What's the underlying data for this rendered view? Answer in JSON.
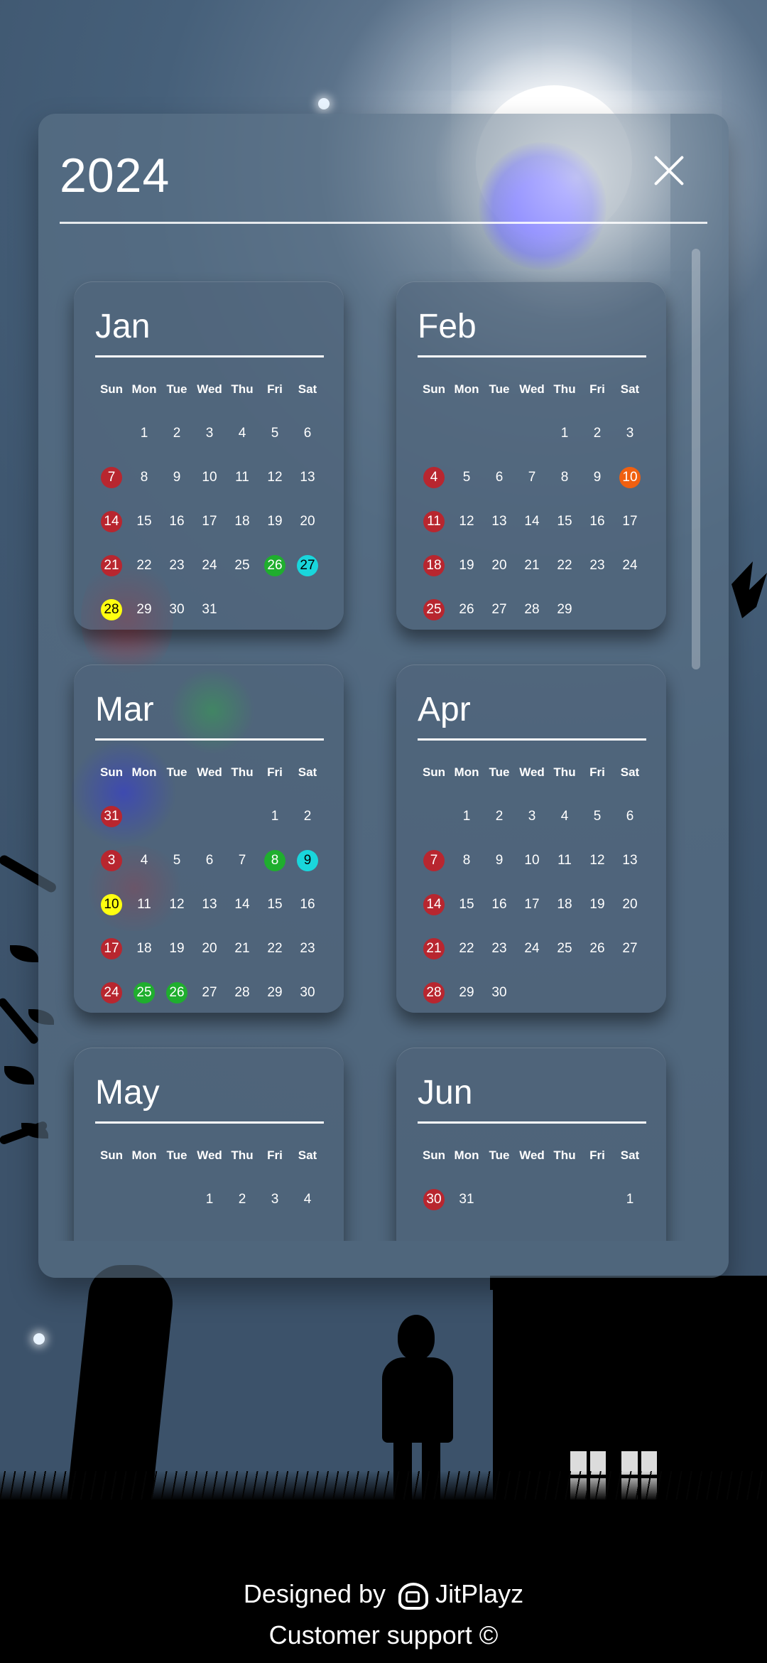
{
  "header": {
    "year": "2024",
    "close_label": "×"
  },
  "weekdays": [
    "Sun",
    "Mon",
    "Tue",
    "Wed",
    "Thu",
    "Fri",
    "Sat"
  ],
  "months": [
    {
      "name": "Jan",
      "start": 1,
      "days": [
        "1",
        "2",
        "3",
        "4",
        "5",
        "6",
        "7",
        "8",
        "9",
        "10",
        "11",
        "12",
        "13",
        "14",
        "15",
        "16",
        "17",
        "18",
        "19",
        "20",
        "21",
        "22",
        "23",
        "24",
        "25",
        "26",
        "27",
        "28",
        "29",
        "30",
        "31"
      ],
      "marks": {
        "7": "red",
        "14": "red",
        "21": "red",
        "26": "green",
        "27": "cyan",
        "28": "yellow"
      }
    },
    {
      "name": "Feb",
      "start": 4,
      "days": [
        "1",
        "2",
        "3",
        "4",
        "5",
        "6",
        "7",
        "8",
        "9",
        "10",
        "11",
        "12",
        "13",
        "14",
        "15",
        "16",
        "17",
        "18",
        "19",
        "20",
        "21",
        "22",
        "23",
        "24",
        "25",
        "26",
        "27",
        "28",
        "29"
      ],
      "marks": {
        "4": "red",
        "10": "orange",
        "11": "red",
        "18": "red",
        "25": "red"
      }
    },
    {
      "name": "Mar",
      "start": 0,
      "days": [
        "31",
        "",
        "",
        "",
        "",
        "1",
        "2",
        "3",
        "4",
        "5",
        "6",
        "7",
        "8",
        "9",
        "10",
        "11",
        "12",
        "13",
        "14",
        "15",
        "16",
        "17",
        "18",
        "19",
        "20",
        "21",
        "22",
        "23",
        "24",
        "25",
        "26",
        "27",
        "28",
        "29",
        "30"
      ],
      "marks": {
        "31": "red",
        "3": "red",
        "8": "green",
        "9": "cyan",
        "10": "yellow",
        "17": "red",
        "24": "red",
        "25": "green",
        "26": "green"
      }
    },
    {
      "name": "Apr",
      "start": 1,
      "days": [
        "1",
        "2",
        "3",
        "4",
        "5",
        "6",
        "7",
        "8",
        "9",
        "10",
        "11",
        "12",
        "13",
        "14",
        "15",
        "16",
        "17",
        "18",
        "19",
        "20",
        "21",
        "22",
        "23",
        "24",
        "25",
        "26",
        "27",
        "28",
        "29",
        "30"
      ],
      "marks": {
        "7": "red",
        "14": "red",
        "21": "red",
        "28": "red"
      }
    },
    {
      "name": "May",
      "start": 3,
      "days": [
        "1",
        "2",
        "3",
        "4"
      ],
      "marks": {}
    },
    {
      "name": "Jun",
      "start": 0,
      "days": [
        "30",
        "31",
        "",
        "",
        "",
        "",
        "1"
      ],
      "marks": {
        "30": "red"
      }
    }
  ],
  "footer": {
    "designed_prefix": "Designed by",
    "designer": "JitPlayz",
    "support": "Customer support ©"
  },
  "colors": {
    "red": "#b8262f",
    "green": "#1fae2e",
    "cyan": "#19d6dc",
    "yellow": "#ffff10",
    "orange": "#f06010"
  }
}
